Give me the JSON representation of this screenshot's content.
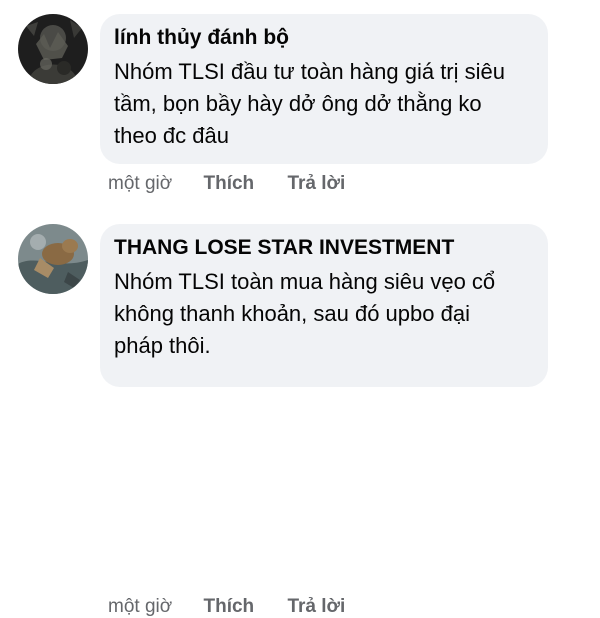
{
  "comments": [
    {
      "author": "lính thủy đánh bộ",
      "avatar_icon": "soldier-avatar",
      "text": "Nhóm TLSI đầu tư toàn hàng giá trị siêu tầm, bọn bầy hày dở ông dở thằng ko theo đc đâu",
      "time": "một giờ",
      "like_label": "Thích",
      "reply_label": "Trả lời"
    },
    {
      "author": "THANG LOSE STAR INVESTMENT",
      "avatar_icon": "animal-photo-avatar",
      "text": "Nhóm TLSI toàn mua hàng siêu vẹo cổ không thanh khoản, sau đó upbo đại pháp thôi.",
      "time": "một giờ",
      "like_label": "Thích",
      "reply_label": "Trả lời"
    }
  ],
  "colors": {
    "bubble_bg": "#f0f2f5",
    "text": "#050505",
    "meta": "#65676b"
  }
}
